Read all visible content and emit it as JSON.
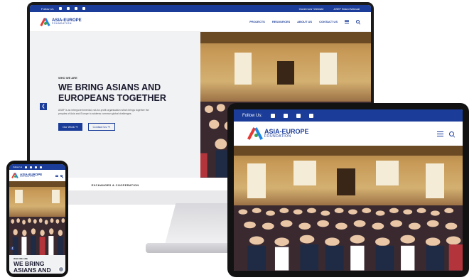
{
  "desktop": {
    "topbar": {
      "follow_label": "Follow Us",
      "links": [
        "Governors' Website",
        "ASEF Brand Manual"
      ]
    },
    "logo": {
      "line1": "ASIA-EUROPE",
      "line2": "FOUNDATION"
    },
    "nav": [
      "PROJECTS",
      "RESOURCES",
      "ABOUT US",
      "CONTACT US"
    ],
    "hero": {
      "eyebrow": "WHO WE ARE",
      "headline": "WE BRING ASIANS AND EUROPEANS TOGETHER",
      "description": "ASEF is an intergovernmental, not-for-profit organisation which brings together the peoples of Asia and Europe to address common global challenges.",
      "primary_button": "Our Work ➔",
      "secondary_button": "Contact Us ➔",
      "arrow": "❮"
    },
    "section_label": "EXCHANGES & COOPERATION"
  },
  "tablet": {
    "topbar": {
      "follow_label": "Follow Us:"
    },
    "logo": {
      "line1": "ASIA-EUROPE",
      "line2": "FOUNDATION"
    }
  },
  "phone": {
    "topbar": {
      "follow_label": "Follow Us"
    },
    "logo": {
      "line1": "ASIA-EUROPE",
      "line2": "FOUNDATION"
    },
    "hero": {
      "eyebrow": "WHO WE ARE",
      "headline": "WE BRING ASIANS AND"
    },
    "arrow": "❮"
  },
  "colors": {
    "brand_blue": "#1b3d99",
    "logo_red": "#e53935",
    "logo_blue": "#1e88e5",
    "logo_green": "#43a047"
  }
}
